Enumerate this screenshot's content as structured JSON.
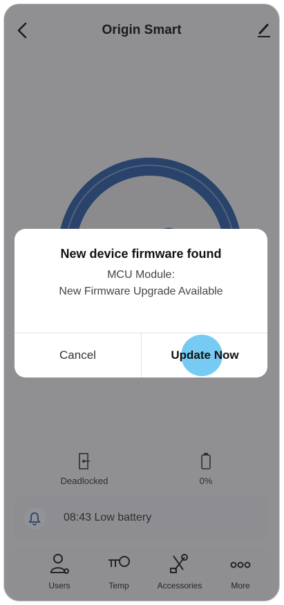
{
  "header": {
    "title": "Origin Smart",
    "back_icon": "chevron-left-icon",
    "edit_icon": "pencil-icon"
  },
  "lock": {
    "icon": "lock-icon",
    "ring_color": "#2c5a9e"
  },
  "status": {
    "deadlock": {
      "label": "Deadlocked",
      "icon": "door-deadlock-icon"
    },
    "battery": {
      "label": "0%",
      "icon": "battery-icon"
    }
  },
  "notification": {
    "text": "08:43 Low battery",
    "icon": "bell-icon"
  },
  "tabs": [
    {
      "label": "Users",
      "icon": "users-icon"
    },
    {
      "label": "Temp",
      "icon": "temp-key-icon"
    },
    {
      "label": "Accessories",
      "icon": "tools-icon"
    },
    {
      "label": "More",
      "icon": "more-dots-icon"
    }
  ],
  "dialog": {
    "title": "New device firmware found",
    "line1": "MCU Module:",
    "line2": "New Firmware Upgrade Available",
    "cancel_label": "Cancel",
    "update_label": "Update Now"
  }
}
